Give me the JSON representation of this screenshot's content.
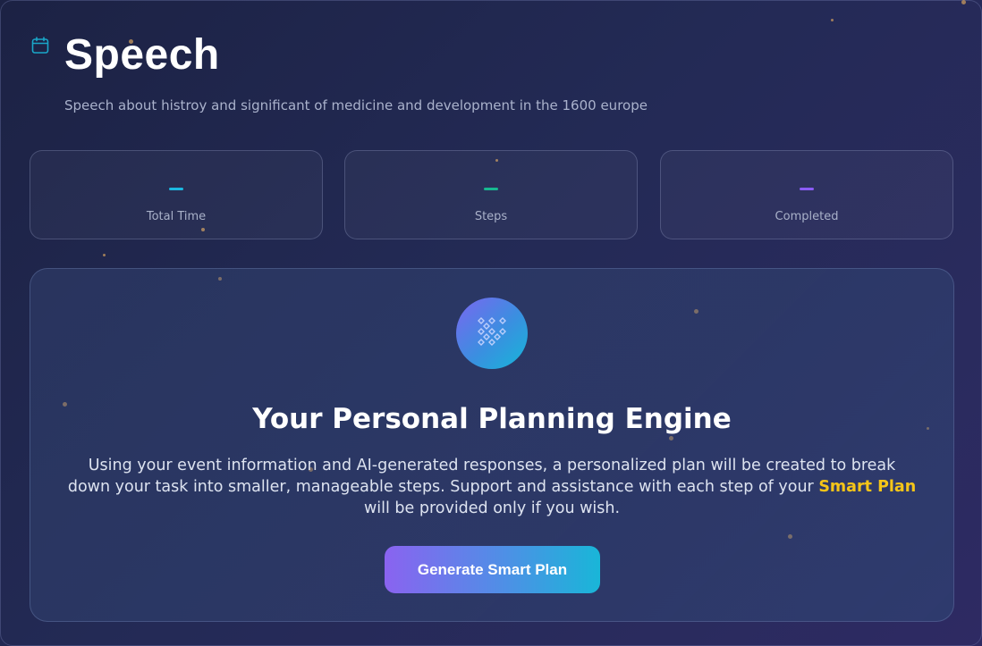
{
  "header": {
    "title": "Speech",
    "subtitle": "Speech about histroy and significant of medicine and development in the 1600 europe",
    "icon": "calendar-icon"
  },
  "stats": [
    {
      "value": "—",
      "label": "Total Time",
      "color": "#1cb8e0"
    },
    {
      "value": "—",
      "label": "Steps",
      "color": "#17b890"
    },
    {
      "value": "—",
      "label": "Completed",
      "color": "#8b5cf6"
    }
  ],
  "engine": {
    "icon": "sparkle-grid-icon",
    "title": "Your Personal Planning Engine",
    "desc_part1": "Using your event information and AI-generated responses, a personalized plan will be created to break down your task into smaller, manageable steps. Support and assistance with each step of your ",
    "desc_highlight": "Smart Plan",
    "desc_part2": " will be provided only if you wish.",
    "button_label": "Generate Smart Plan"
  },
  "colors": {
    "accent_highlight": "#f5c518",
    "button_gradient_start": "#8a63f0",
    "button_gradient_end": "#19b6d8"
  }
}
